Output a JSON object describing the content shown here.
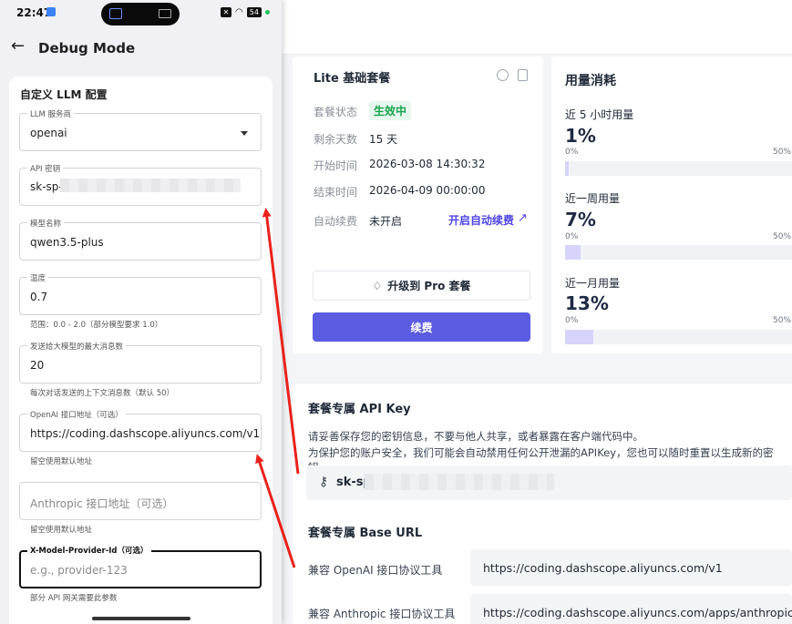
{
  "phone": {
    "status": {
      "time": "22:47",
      "battery": "54"
    },
    "appbar": {
      "back_icon": "←",
      "title": "Debug Mode"
    },
    "section_title": "自定义 LLM 配置",
    "fields": {
      "llm_service": {
        "label": "LLM 服务商",
        "value": "openai"
      },
      "api_key": {
        "label": "API 密钥",
        "value": "sk-sp-"
      },
      "model_name": {
        "label": "模型名称",
        "value": "qwen3.5-plus"
      },
      "temperature": {
        "label": "温度",
        "value": "0.7",
        "helper": "范围：0.0 - 2.0（部分模型要求 1.0）"
      },
      "max_messages": {
        "label": "发送给大模型的最大消息数",
        "value": "20",
        "helper": "每次对话发送的上下文消息数（默认 50）"
      },
      "openai_url": {
        "label": "OpenAI 接口地址（可选）",
        "value": "https://coding.dashscope.aliyuncs.com/v1",
        "helper": "留空使用默认地址"
      },
      "anthropic_url": {
        "placeholder": "Anthropic 接口地址（可选）",
        "helper": "留空使用默认地址"
      },
      "provider_id": {
        "label": "X-Model-Provider-Id（可选）",
        "placeholder": "e.g., provider-123",
        "helper": "部分 API 网关需要此参数"
      }
    }
  },
  "plan": {
    "title": "Lite 基础套餐",
    "status_label": "套餐状态",
    "status_value": "生效中",
    "days_label": "剩余天数",
    "days_value": "15 天",
    "start_label": "开始时间",
    "start_value": "2026-03-08 14:30:32",
    "end_label": "结束时间",
    "end_value": "2026-04-09 00:00:00",
    "auto_label": "自动续费",
    "auto_value": "未开启",
    "auto_link": "开启自动续费",
    "upgrade_button": "升级到 Pro 套餐",
    "renew_button": "续费"
  },
  "usage": {
    "title": "用量消耗",
    "items": [
      {
        "label": "近 5 小时用量",
        "percent": "1%",
        "tick_min": "0%",
        "tick_max": "50%",
        "value": 1
      },
      {
        "label": "近一周用量",
        "percent": "7%",
        "tick_min": "0%",
        "tick_max": "50%",
        "value": 7
      },
      {
        "label": "近一月用量",
        "percent": "13%",
        "tick_min": "0%",
        "tick_max": "50%",
        "value": 13
      }
    ]
  },
  "api_key": {
    "title": "套餐专属 API Key",
    "desc1": "请妥善保存您的密钥信息，不要与他人共享，或者暴露在客户端代码中。",
    "desc2": "为保护您的账户安全，我们可能会自动禁用任何公开泄漏的APIKey，您也可以随时重置以生成新的密钥。",
    "value": "sk-sp"
  },
  "base_url": {
    "title": "套餐专属 Base URL",
    "openai_label": "兼容 OpenAI 接口协议工具",
    "openai_value": "https://coding.dashscope.aliyuncs.com/v1",
    "anthropic_label": "兼容 Anthropic 接口协议工具",
    "anthropic_value": "https://coding.dashscope.aliyuncs.com/apps/anthropic"
  },
  "colors": {
    "accent": "#5b5ce2",
    "annotation": "#e8221b",
    "success": "#16a34a"
  }
}
